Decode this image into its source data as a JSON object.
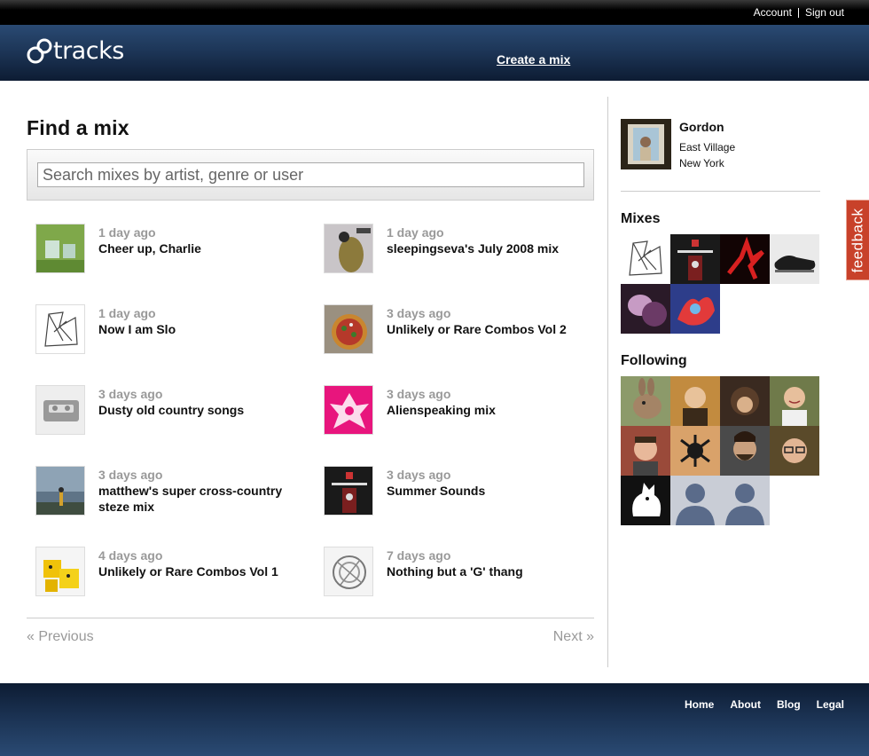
{
  "topbar": {
    "account": "Account",
    "signout": "Sign out"
  },
  "header": {
    "logo": "tracks",
    "create": "Create a mix"
  },
  "find": {
    "title": "Find a mix",
    "search_placeholder": "Search mixes by artist, genre or user",
    "mixes": [
      {
        "when": "1 day ago",
        "name": "Cheer up, Charlie",
        "art": "green-toy"
      },
      {
        "when": "1 day ago",
        "name": "sleepingseva's July 2008 mix",
        "art": "peacock-figure"
      },
      {
        "when": "1 day ago",
        "name": "Now I am Slo",
        "art": "line-drawing"
      },
      {
        "when": "3 days ago",
        "name": "Unlikely or Rare Combos Vol 2",
        "art": "pizza"
      },
      {
        "when": "3 days ago",
        "name": "Dusty old country songs",
        "art": "cassette"
      },
      {
        "when": "3 days ago",
        "name": "Alienspeaking mix",
        "art": "pink-poster"
      },
      {
        "when": "3 days ago",
        "name": "matthew's super cross-country steze mix",
        "art": "stormy-sky"
      },
      {
        "when": "3 days ago",
        "name": "Summer Sounds",
        "art": "black-poster"
      },
      {
        "when": "4 days ago",
        "name": "Unlikely or Rare Combos Vol 1",
        "art": "yellow-toys"
      },
      {
        "when": "7 days ago",
        "name": "Nothing but a 'G' thang",
        "art": "sketch"
      }
    ],
    "prev": "« Previous",
    "next": "Next »"
  },
  "profile": {
    "name": "Gordon",
    "loc1": "East Village",
    "loc2": "New York"
  },
  "sidebar": {
    "mixes_title": "Mixes",
    "following_title": "Following",
    "mix_tiles": [
      "line-drawing",
      "black-poster",
      "red-dancer",
      "shoes",
      "purple-photo",
      "red-blue-paint"
    ],
    "following_tiles": [
      "rabbit",
      "man-bald",
      "person-hair",
      "man-smile",
      "man-red",
      "tattoo",
      "man-beard",
      "man-glasses",
      "rooster",
      "default-avatar",
      "default-avatar"
    ]
  },
  "feedback": "feedback",
  "footer": {
    "home": "Home",
    "about": "About",
    "blog": "Blog",
    "legal": "Legal"
  },
  "colors": {
    "header": "#1c3455",
    "feedback": "#c8412a",
    "muted": "#999999"
  }
}
